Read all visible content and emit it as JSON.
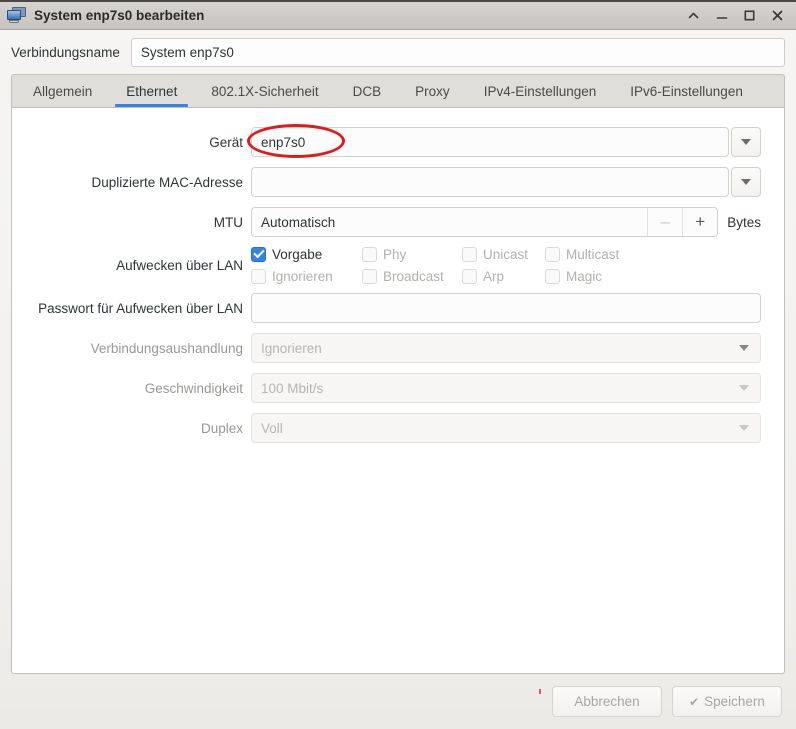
{
  "window": {
    "title": "System enp7s0 bearbeiten",
    "icon": "network-monitors-icon",
    "buttons": {
      "shade": "^",
      "minimize": "_",
      "maximize": "[]",
      "close": "x"
    }
  },
  "connection": {
    "label": "Verbindungsname",
    "value": "System enp7s0",
    "placeholder": ""
  },
  "tabs": [
    {
      "label": "Allgemein",
      "active": false
    },
    {
      "label": "Ethernet",
      "active": true
    },
    {
      "label": "802.1X-Sicherheit",
      "active": false
    },
    {
      "label": "DCB",
      "active": false
    },
    {
      "label": "Proxy",
      "active": false
    },
    {
      "label": "IPv4-Einstellungen",
      "active": false
    },
    {
      "label": "IPv6-Einstellungen",
      "active": false
    }
  ],
  "form": {
    "device": {
      "label": "Gerät",
      "value": "enp7s0",
      "disabled": false
    },
    "cloned_mac": {
      "label": "Duplizierte MAC-Adresse",
      "value": "",
      "disabled": false
    },
    "mtu": {
      "label": "MTU",
      "value": "Automatisch",
      "unit": "Bytes",
      "minus": "–",
      "plus": "+"
    },
    "wake_on_lan": {
      "label": "Aufwecken über LAN",
      "options": [
        {
          "label": "Vorgabe",
          "checked": true,
          "enabled": true
        },
        {
          "label": "Phy",
          "checked": false,
          "enabled": false
        },
        {
          "label": "Unicast",
          "checked": false,
          "enabled": false
        },
        {
          "label": "Multicast",
          "checked": false,
          "enabled": false
        },
        {
          "label": "Ignorieren",
          "checked": false,
          "enabled": false
        },
        {
          "label": "Broadcast",
          "checked": false,
          "enabled": false
        },
        {
          "label": "Arp",
          "checked": false,
          "enabled": false
        },
        {
          "label": "Magic",
          "checked": false,
          "enabled": false
        }
      ]
    },
    "wol_password": {
      "label": "Passwort für Aufwecken über LAN",
      "value": "",
      "disabled": false
    },
    "link_negotiation": {
      "label": "Verbindungsaushandlung",
      "value": "Ignorieren",
      "disabled": true
    },
    "speed": {
      "label": "Geschwindigkeit",
      "value": "100 Mbit/s",
      "disabled": true
    },
    "duplex": {
      "label": "Duplex",
      "value": "Voll",
      "disabled": true
    }
  },
  "footer": {
    "cancel": "Abbrechen",
    "save": "Speichern",
    "save_icon": "✔"
  },
  "annotation": {
    "shape": "ellipse",
    "color": "#e01b1b",
    "target": "enp7s0"
  }
}
